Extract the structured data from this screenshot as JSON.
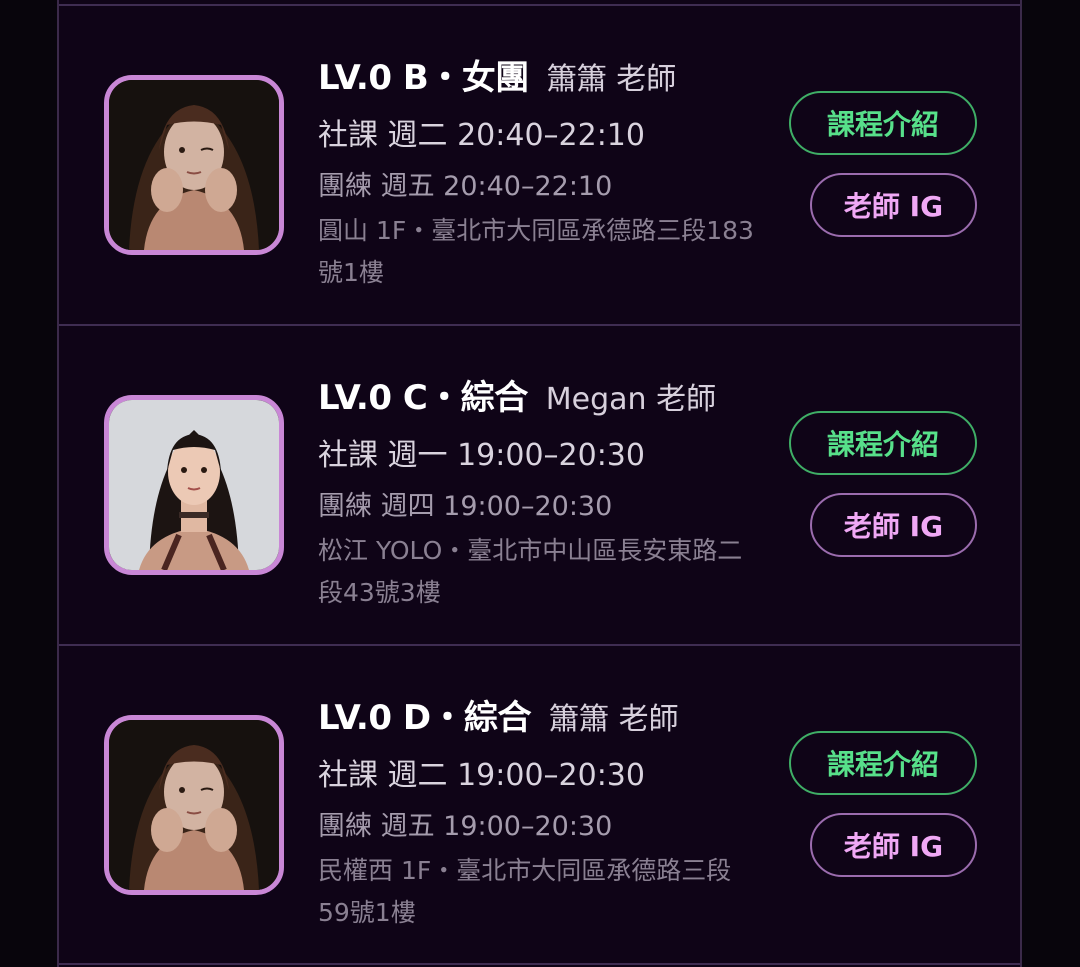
{
  "courses": [
    {
      "title": "LV.0 B・女團",
      "teacher": "簫簫 老師",
      "class_time": "社課 週二 20:40–22:10",
      "team_time": "團練 週五 20:40–22:10",
      "address": "圓山 1F・臺北市大同區承德路三段183號1樓",
      "intro_label": "課程介紹",
      "ig_label": "老師 IG",
      "avatar": "teacher-photo-xiaoxiao"
    },
    {
      "title": "LV.0 C・綜合",
      "teacher": "Megan 老師",
      "class_time": "社課 週一 19:00–20:30",
      "team_time": "團練 週四 19:00–20:30",
      "address": "松江 YOLO・臺北市中山區長安東路二段43號3樓",
      "intro_label": "課程介紹",
      "ig_label": "老師 IG",
      "avatar": "teacher-photo-megan"
    },
    {
      "title": "LV.0 D・綜合",
      "teacher": "簫簫 老師",
      "class_time": "社課 週二 19:00–20:30",
      "team_time": "團練 週五 19:00–20:30",
      "address": "民權西 1F・臺北市大同區承德路三段59號1樓",
      "intro_label": "課程介紹",
      "ig_label": "老師 IG",
      "avatar": "teacher-photo-xiaoxiao"
    }
  ],
  "colors": {
    "background": "#0f0417",
    "divider": "#3f2d52",
    "intro_accent": "#57e08a",
    "ig_accent": "#f0a8f5",
    "avatar_border": "#c987d6"
  }
}
